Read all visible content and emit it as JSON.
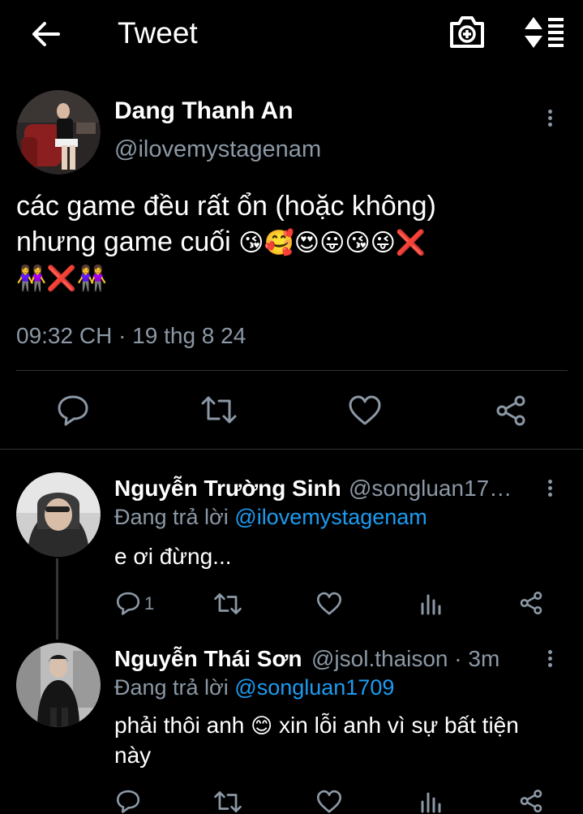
{
  "header": {
    "title": "Tweet",
    "back_icon": "arrow-left-icon",
    "camera_icon": "camera-plus-icon",
    "sort_icon": "sort-list-icon"
  },
  "tweet": {
    "author_name": "Dang Thanh An",
    "handle": "@ilovemystagenam",
    "text_line1": "các game đều rất ổn (hoặc không)",
    "text_line2": "nhưng game cuối",
    "text_line2_emoji": "😘🥰😍😛😘😜❌",
    "text_line3_emoji": "👭❌👭",
    "timestamp": "09:32 CH · 19 thg 8 24"
  },
  "replies": [
    {
      "author_name": "Nguyễn Trường Sinh",
      "handle_meta": "@songluan17…",
      "replying_prefix": "Đang trả lời",
      "replying_to": "@ilovemystagenam",
      "text": "e ơi đừng...",
      "reply_count": "1"
    },
    {
      "author_name": "Nguyễn Thái Sơn",
      "handle_meta": "@jsol.thaison · 3m",
      "replying_prefix": "Đang trả lời",
      "replying_to": "@songluan1709",
      "text_line1": "phải thôi anh",
      "text_emoji": "😊",
      "text_line1_rest": "xin lỗi anh vì sự bất tiện",
      "text_line2": "này"
    }
  ],
  "colors": {
    "background": "#000000",
    "text": "#e7e9ea",
    "muted": "#8b98a5",
    "link": "#1d9bf0",
    "divider": "#2f3336"
  }
}
